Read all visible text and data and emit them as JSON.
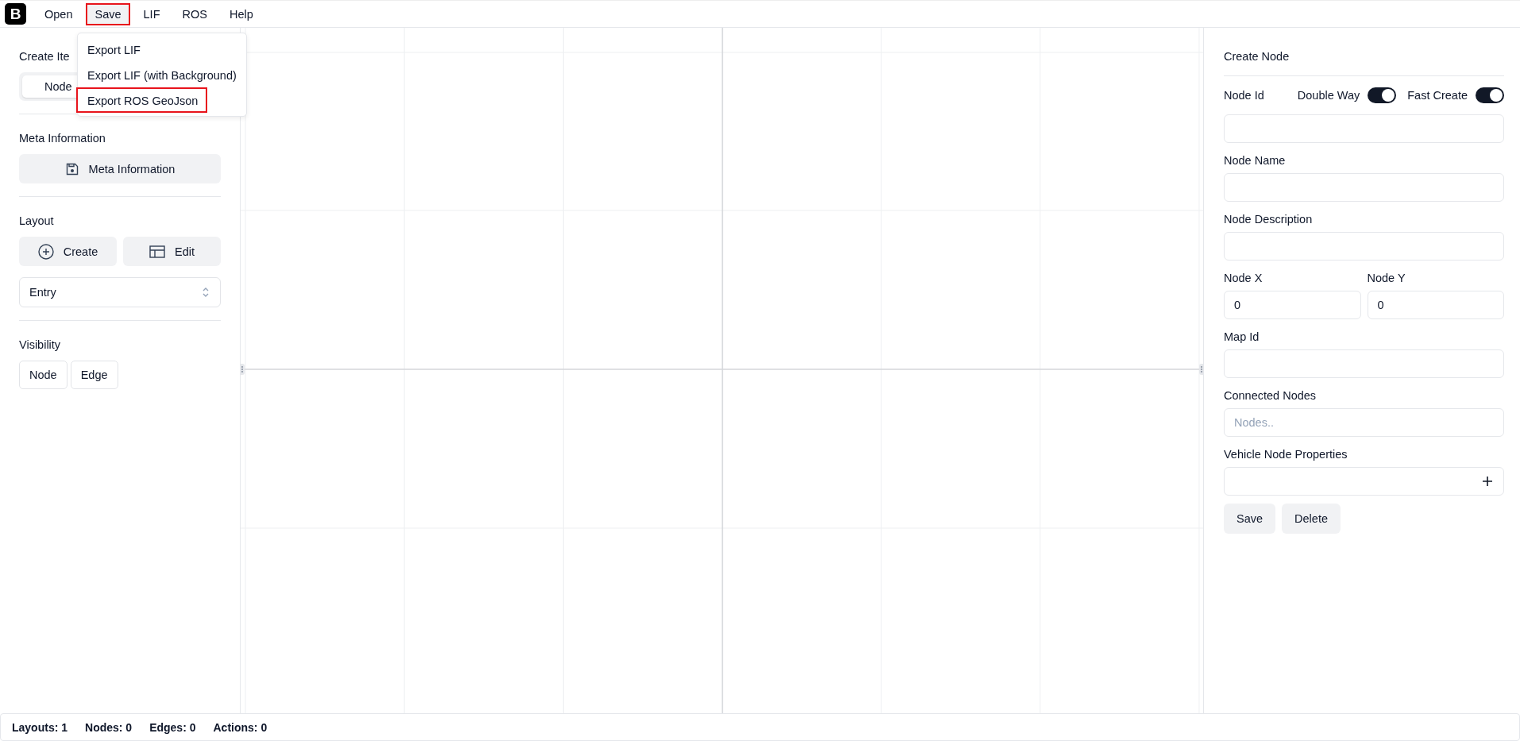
{
  "menu": {
    "logo": "B",
    "items": [
      {
        "label": "Open",
        "highlighted": false
      },
      {
        "label": "Save",
        "highlighted": true
      },
      {
        "label": "LIF",
        "highlighted": false
      },
      {
        "label": "ROS",
        "highlighted": false
      },
      {
        "label": "Help",
        "highlighted": false
      }
    ]
  },
  "dropdown": {
    "items": [
      {
        "label": "Export LIF",
        "highlighted": false
      },
      {
        "label": "Export LIF (with Background)",
        "highlighted": false
      },
      {
        "label": "Export ROS GeoJson",
        "highlighted": true
      }
    ]
  },
  "sidebar": {
    "create_item": {
      "title": "Create Ite",
      "tabs": [
        {
          "label": "Node",
          "selected": true
        }
      ]
    },
    "meta": {
      "title": "Meta Information",
      "button": "Meta Information"
    },
    "layout": {
      "title": "Layout",
      "buttons": [
        {
          "label": "Create",
          "kind": "create"
        },
        {
          "label": "Edit",
          "kind": "edit"
        }
      ],
      "select": {
        "value": "Entry"
      }
    },
    "visibility": {
      "title": "Visibility",
      "buttons": [
        {
          "label": "Node"
        },
        {
          "label": "Edge"
        }
      ]
    }
  },
  "panel": {
    "title": "Create Node",
    "node_id_label": "Node Id",
    "toggles": [
      {
        "label": "Double Way",
        "on": true
      },
      {
        "label": "Fast Create",
        "on": true
      }
    ],
    "fields": [
      {
        "label": "Node Name"
      },
      {
        "label": "Node Description"
      }
    ],
    "coords": [
      {
        "label": "Node X",
        "value": "0"
      },
      {
        "label": "Node Y",
        "value": "0"
      }
    ],
    "map_id": {
      "label": "Map Id"
    },
    "connected_nodes": {
      "label": "Connected Nodes",
      "placeholder": "Nodes.."
    },
    "vehicle_properties": {
      "label": "Vehicle Node Properties"
    },
    "buttons": [
      "Save",
      "Delete"
    ]
  },
  "status_bar": [
    "Layouts: 1",
    "Nodes: 0",
    "Edges: 0",
    "Actions: 0"
  ]
}
